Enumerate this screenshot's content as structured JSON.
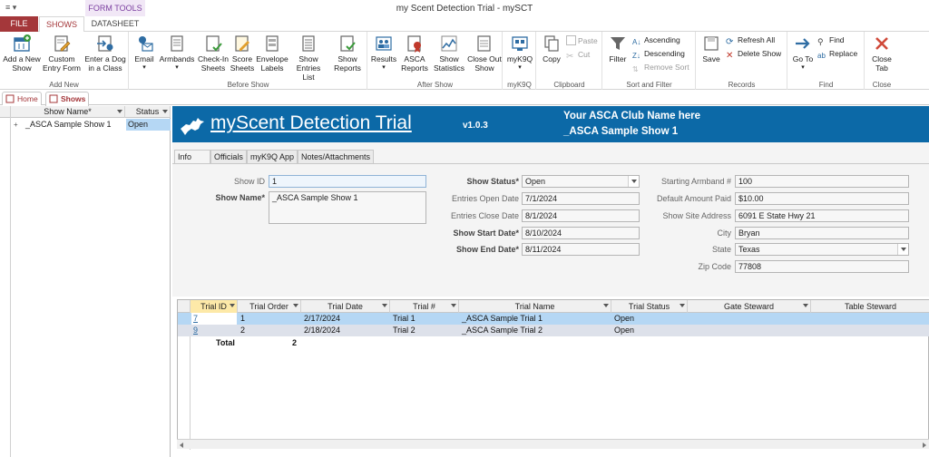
{
  "window": {
    "title": "my Scent Detection Trial - mySCT",
    "quick_access": "≡  ▾"
  },
  "ribbon_tabs": {
    "file": "FILE",
    "shows": "SHOWS",
    "datasheet": "DATASHEET",
    "context": "FORM TOOLS"
  },
  "ribbon": {
    "add_new": {
      "label": "Add New",
      "add_show": "Add a New Show",
      "custom_entry": "Custom Entry Form",
      "enter_dog": "Enter a Dog in a Class"
    },
    "before_show": {
      "label": "Before Show",
      "email": "Email",
      "armbands": "Armbands",
      "checkin": "Check-In Sheets",
      "score_sheets": "Score Sheets",
      "envelope": "Envelope Labels",
      "show_entries": "Show Entries List",
      "show_reports": "Show Reports"
    },
    "after_show": {
      "label": "After Show",
      "results": "Results",
      "asca_reports": "ASCA Reports",
      "show_statistics": "Show Statistics",
      "close_out": "Close Out Show"
    },
    "myk9q": {
      "label": "myK9Q",
      "btn": "myK9Q"
    },
    "clipboard": {
      "label": "Clipboard",
      "copy": "Copy",
      "paste": "Paste",
      "cut": "Cut"
    },
    "sort_filter": {
      "label": "Sort and Filter",
      "filter": "Filter",
      "ascending": "Ascending",
      "descending": "Descending",
      "remove_sort": "Remove Sort"
    },
    "records": {
      "label": "Records",
      "save": "Save",
      "refresh_all": "Refresh All",
      "delete_show": "Delete Show"
    },
    "find": {
      "label": "Find",
      "goto": "Go To",
      "find": "Find",
      "replace": "Replace"
    },
    "close": {
      "label": "Close",
      "close_tab": "Close Tab"
    }
  },
  "doc_tabs": {
    "home": "Home",
    "shows": "Shows"
  },
  "left_list": {
    "col_name": "Show Name*",
    "col_status": "Status",
    "rows": [
      {
        "expand": "+",
        "name": "_ASCA Sample Show 1",
        "status": "Open"
      }
    ]
  },
  "banner": {
    "app_title": "myScent Detection Trial",
    "version": "v1.0.3",
    "club": "Your ASCA Club Name here",
    "show_name": "_ASCA Sample Show 1"
  },
  "form_tabs": {
    "info": "Info",
    "officials": "Officials",
    "myk9q_app": "myK9Q App",
    "notes": "Notes/Attachments"
  },
  "fields": {
    "show_id": {
      "label": "Show ID",
      "value": "1"
    },
    "show_name": {
      "label": "Show Name*",
      "value": "_ASCA Sample Show 1"
    },
    "show_status": {
      "label": "Show Status*",
      "value": "Open"
    },
    "entries_open": {
      "label": "Entries Open Date",
      "value": "7/1/2024"
    },
    "entries_close": {
      "label": "Entries Close Date",
      "value": "8/1/2024"
    },
    "show_start": {
      "label": "Show Start Date*",
      "value": "8/10/2024"
    },
    "show_end": {
      "label": "Show End Date*",
      "value": "8/11/2024"
    },
    "start_armband": {
      "label": "Starting Armband #",
      "value": "100"
    },
    "default_amount": {
      "label": "Default Amount Paid",
      "value": "$10.00"
    },
    "site_address": {
      "label": "Show Site Address",
      "value": "6091 E State Hwy 21"
    },
    "city": {
      "label": "City",
      "value": "Bryan"
    },
    "state": {
      "label": "State",
      "value": "Texas"
    },
    "zip": {
      "label": "Zip Code",
      "value": "77808"
    }
  },
  "grid": {
    "headers": [
      "Trial ID",
      "Trial Order",
      "Trial Date",
      "Trial #",
      "Trial Name",
      "Trial Status",
      "Gate Steward",
      "Table Steward"
    ],
    "rows": [
      {
        "id": "7",
        "order": "1",
        "date": "2/17/2024",
        "num": "Trial 1",
        "name": "_ASCA Sample Trial 1",
        "status": "Open"
      },
      {
        "id": "9",
        "order": "2",
        "date": "2/18/2024",
        "num": "Trial 2",
        "name": "_ASCA Sample Trial 2",
        "status": "Open"
      }
    ],
    "total_label": "Total",
    "total_value": "2"
  },
  "colors": {
    "accent": "#a4373a",
    "banner": "#0c69a7",
    "row_selected": "#b5d7f4",
    "row_alt": "#dde1ea"
  }
}
